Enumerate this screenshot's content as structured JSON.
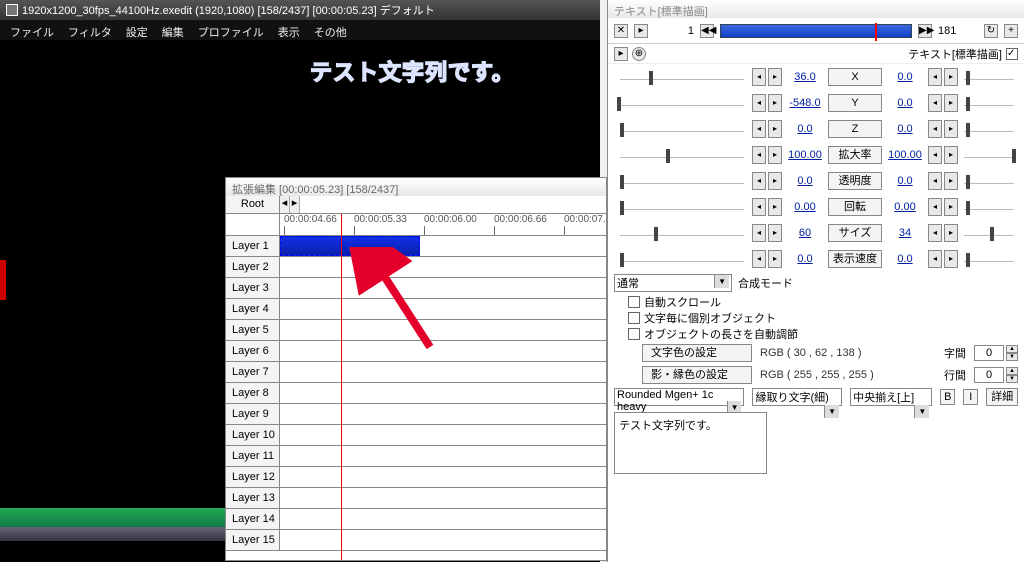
{
  "main": {
    "title": "1920x1200_30fps_44100Hz.exedit (1920,1080)  [158/2437] [00:00:05.23] デフォルト",
    "menu": [
      "ファイル",
      "フィルタ",
      "設定",
      "編集",
      "プロファイル",
      "表示",
      "その他"
    ],
    "preview_text": "テスト文字列です。"
  },
  "timeline": {
    "title": "拡張編集 [00:00:05.23] [158/2437]",
    "root": "Root",
    "ticks": [
      "00:00:04.66",
      "00:00:05.33",
      "00:00:06.00",
      "00:00:06.66",
      "00:00:07.33"
    ],
    "layers": [
      "Layer 1",
      "Layer 2",
      "Layer 3",
      "Layer 4",
      "Layer 5",
      "Layer 6",
      "Layer 7",
      "Layer 8",
      "Layer 9",
      "Layer 10",
      "Layer 11",
      "Layer 12",
      "Layer 13",
      "Layer 14",
      "Layer 15"
    ]
  },
  "props": {
    "title": "テキスト[標準描画]",
    "frame_start": "1",
    "frame_end": "181",
    "section_label": "テキスト[標準描画]",
    "params": [
      {
        "name": "X",
        "v1": "36.0",
        "v2": "0.0",
        "t1": 35,
        "t2": 6
      },
      {
        "name": "Y",
        "v1": "-548.0",
        "v2": "0.0",
        "t1": 3,
        "t2": 6
      },
      {
        "name": "Z",
        "v1": "0.0",
        "v2": "0.0",
        "t1": 6,
        "t2": 6
      },
      {
        "name": "拡大率",
        "v1": "100.00",
        "v2": "100.00",
        "t1": 52,
        "t2": 52
      },
      {
        "name": "透明度",
        "v1": "0.0",
        "v2": "0.0",
        "t1": 6,
        "t2": 6
      },
      {
        "name": "回転",
        "v1": "0.00",
        "v2": "0.00",
        "t1": 6,
        "t2": 6
      },
      {
        "name": "サイズ",
        "v1": "60",
        "v2": "34",
        "t1": 40,
        "t2": 30
      },
      {
        "name": "表示速度",
        "v1": "0.0",
        "v2": "0.0",
        "t1": 6,
        "t2": 6
      }
    ],
    "blend_mode_label": "合成モード",
    "blend_mode": "通常",
    "checks": [
      {
        "label": "自動スクロール",
        "on": false
      },
      {
        "label": "文字毎に個別オブジェクト",
        "on": false
      },
      {
        "label": "オブジェクトの長さを自動調節",
        "on": false
      }
    ],
    "text_color_label": "文字色の設定",
    "text_color_rgb": "RGB ( 30 , 62 , 138 )",
    "shadow_color_label": "影・縁色の設定",
    "shadow_color_rgb": "RGB ( 255 , 255 , 255 )",
    "char_spacing_label": "字間",
    "char_spacing": "0",
    "line_spacing_label": "行間",
    "line_spacing": "0",
    "font": "Rounded Mgen+ 1c heavy",
    "style": "縁取り文字(細)",
    "align": "中央揃え[上]",
    "detail": "詳細",
    "b": "B",
    "i": "I",
    "text_value": "テスト文字列です。"
  }
}
